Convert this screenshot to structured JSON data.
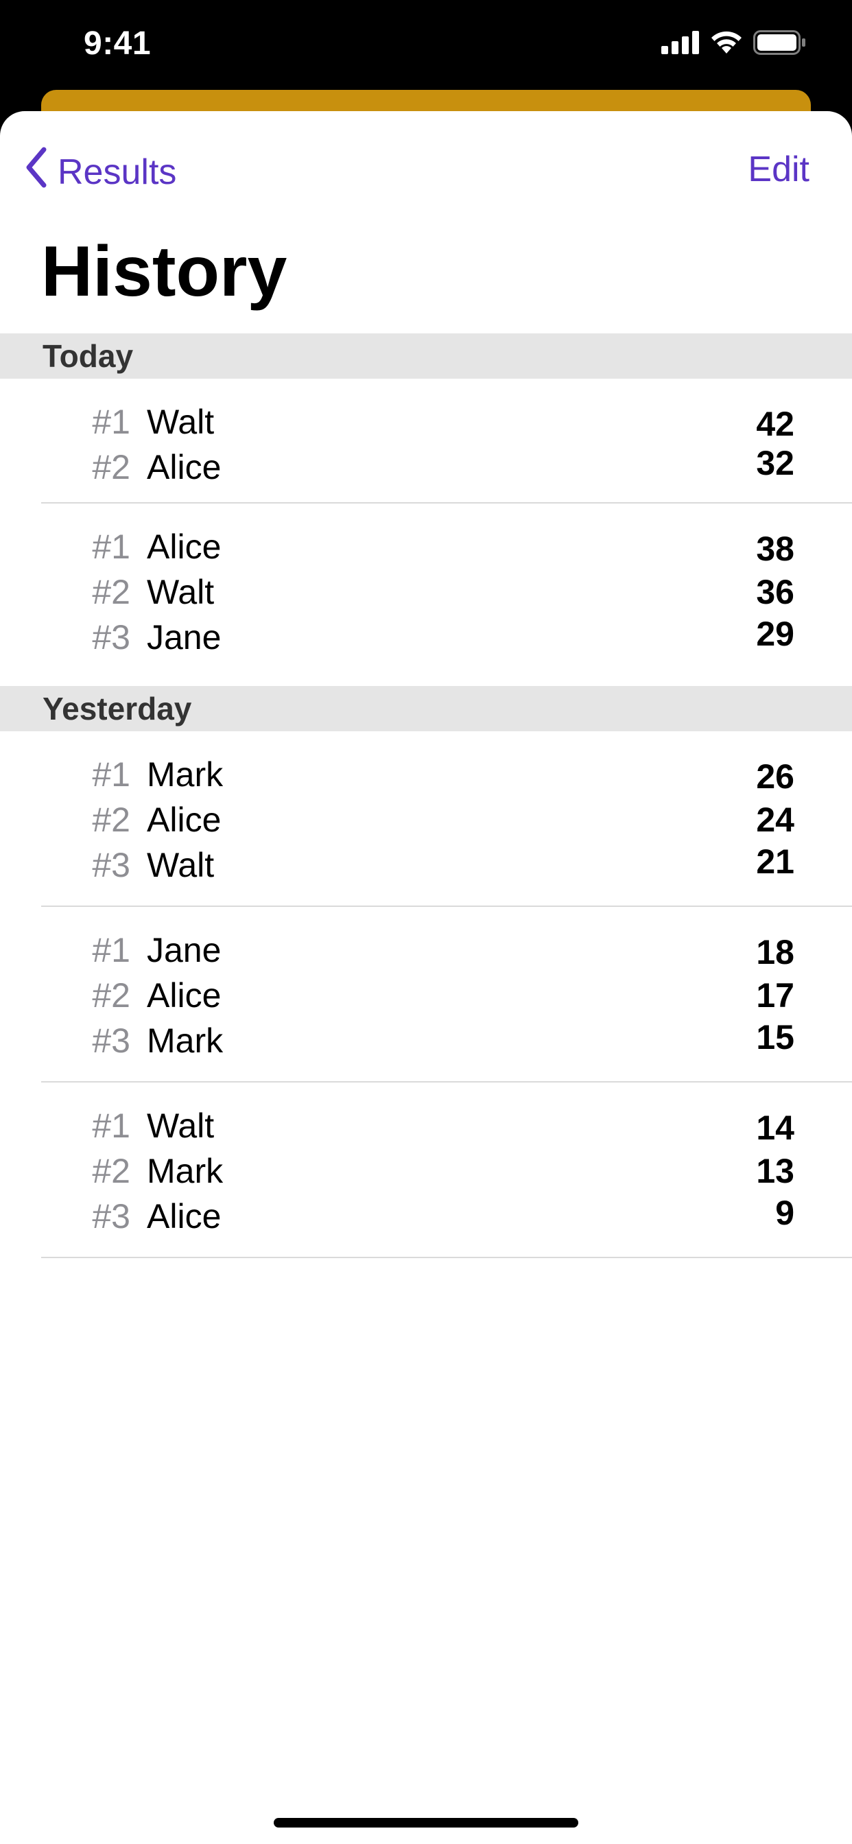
{
  "status_bar": {
    "time": "9:41",
    "icons": [
      "cellular-signal-icon",
      "wifi-icon",
      "battery-icon"
    ]
  },
  "nav": {
    "back_label": "Results",
    "edit_label": "Edit"
  },
  "title": "History",
  "colors": {
    "accent": "#5B35C5",
    "card_peek": "#C8900E",
    "section_header_bg": "#E5E5E5",
    "rank_gray": "#8E8E93"
  },
  "sections": [
    {
      "label": "Today",
      "games": [
        {
          "entries": [
            {
              "rank": "#1",
              "player": "Walt",
              "score": "42"
            },
            {
              "rank": "#2",
              "player": "Alice",
              "score": "32"
            }
          ]
        },
        {
          "entries": [
            {
              "rank": "#1",
              "player": "Alice",
              "score": "38"
            },
            {
              "rank": "#2",
              "player": "Walt",
              "score": "36"
            },
            {
              "rank": "#3",
              "player": "Jane",
              "score": "29"
            }
          ]
        }
      ]
    },
    {
      "label": "Yesterday",
      "games": [
        {
          "entries": [
            {
              "rank": "#1",
              "player": "Mark",
              "score": "26"
            },
            {
              "rank": "#2",
              "player": "Alice",
              "score": "24"
            },
            {
              "rank": "#3",
              "player": "Walt",
              "score": "21"
            }
          ]
        },
        {
          "entries": [
            {
              "rank": "#1",
              "player": "Jane",
              "score": "18"
            },
            {
              "rank": "#2",
              "player": "Alice",
              "score": "17"
            },
            {
              "rank": "#3",
              "player": "Mark",
              "score": "15"
            }
          ]
        },
        {
          "entries": [
            {
              "rank": "#1",
              "player": "Walt",
              "score": "14"
            },
            {
              "rank": "#2",
              "player": "Mark",
              "score": "13"
            },
            {
              "rank": "#3",
              "player": "Alice",
              "score": "9"
            }
          ]
        }
      ]
    }
  ]
}
